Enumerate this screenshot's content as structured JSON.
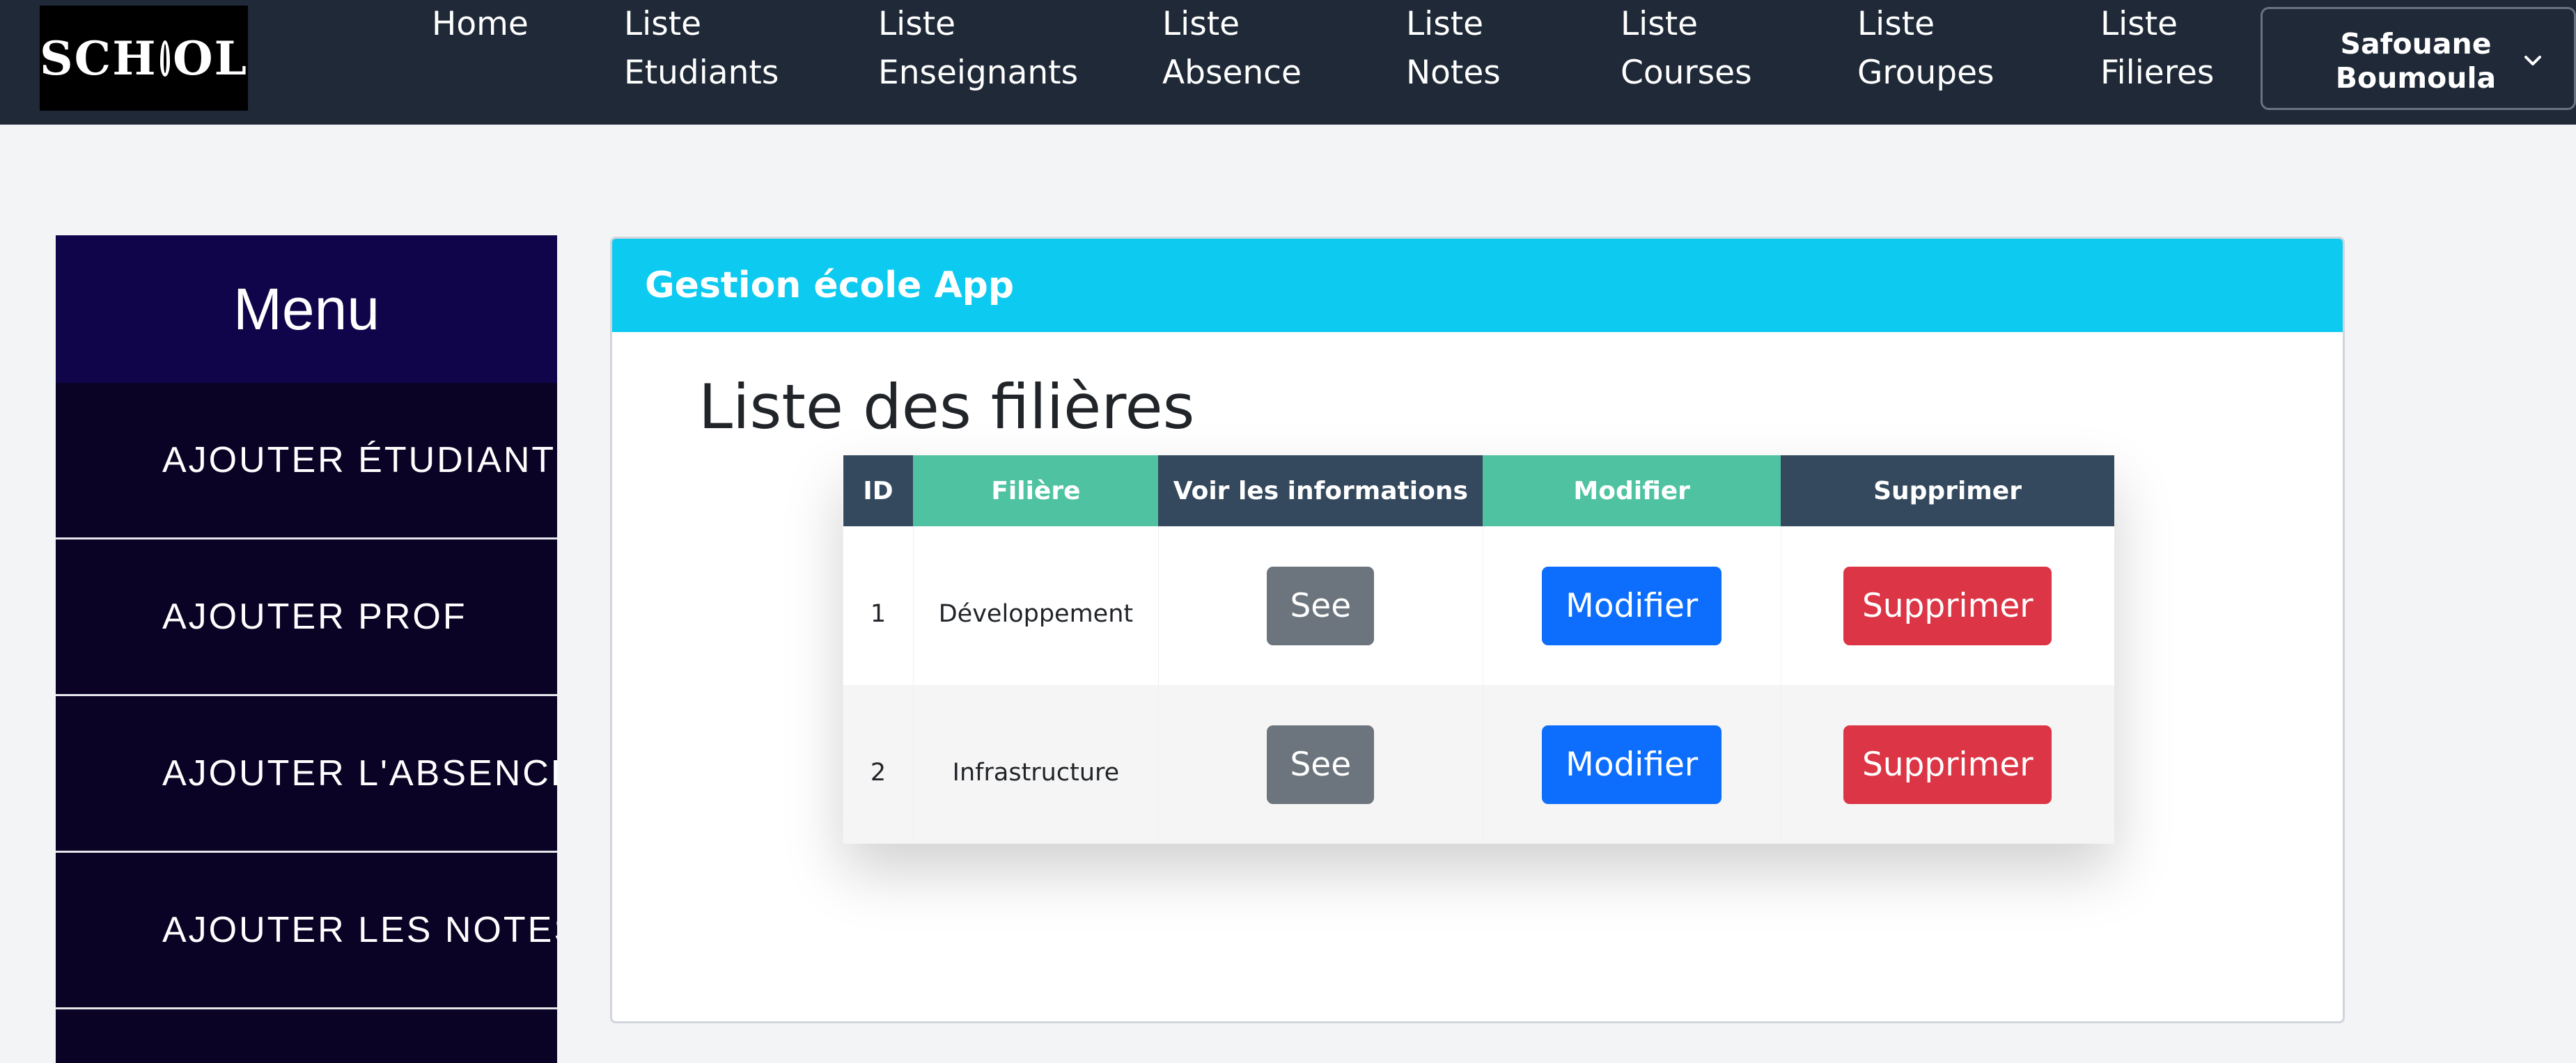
{
  "navbar": {
    "logo_text": "SCHOOL",
    "links": [
      {
        "label": "Home"
      },
      {
        "label": "Liste\nEtudiants"
      },
      {
        "label": "Liste\nEnseignants"
      },
      {
        "label": "Liste\nAbsence"
      },
      {
        "label": "Liste\nNotes"
      },
      {
        "label": "Liste\nCourses"
      },
      {
        "label": "Liste\nGroupes"
      },
      {
        "label": "Liste\nFilieres"
      }
    ],
    "user": {
      "name": "Safouane Boumoula",
      "icon": "chevron-down-icon"
    }
  },
  "sidebar": {
    "title": "Menu",
    "items": [
      {
        "label": "AJOUTER ÉTUDIANT"
      },
      {
        "label": "AJOUTER PROF"
      },
      {
        "label": "AJOUTER L'ABSENCE"
      },
      {
        "label": "AJOUTER LES NOTES"
      }
    ]
  },
  "card": {
    "header": "Gestion école App",
    "page_title": "Liste des filières",
    "table": {
      "headers": [
        "ID",
        "Filière",
        "Voir les informations",
        "Modifier",
        "Supprimer"
      ],
      "rows": [
        {
          "id": "1",
          "filiere": "Développement",
          "see": "See",
          "modify": "Modifier",
          "delete": "Supprimer"
        },
        {
          "id": "2",
          "filiere": "Infrastructure",
          "see": "See",
          "modify": "Modifier",
          "delete": "Supprimer"
        }
      ]
    }
  },
  "colors": {
    "navbar": "#1f2937",
    "sidebar": "#0b0326",
    "sidebar_header": "#10054a",
    "card_header": "#0dcaf0",
    "header_dark": "#34495e",
    "header_green": "#4fc3a1",
    "btn_see": "#6c757d",
    "btn_modify": "#0d6efd",
    "btn_delete": "#dc3545"
  }
}
